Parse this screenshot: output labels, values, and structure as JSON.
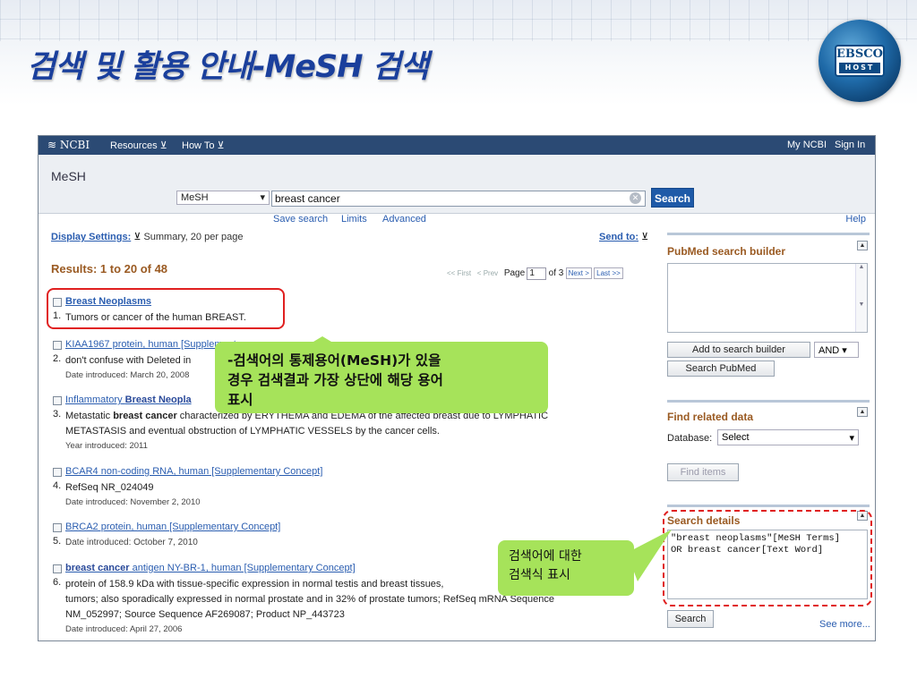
{
  "slide": {
    "title": "검색 및 활용 안내-MeSH 검색",
    "logo": {
      "line1": "EBSCO",
      "line2": "HOST"
    }
  },
  "topbar": {
    "brand": "NCBI",
    "resources": "Resources",
    "howto": "How To",
    "my_ncbi": "My NCBI",
    "sign_in": "Sign In"
  },
  "masthead": {
    "db_title": "MeSH",
    "db_select": "MeSH",
    "search_value": "breast cancer",
    "search_button": "Search",
    "links": [
      "Save search",
      "Limits",
      "Advanced"
    ],
    "help": "Help"
  },
  "results_header": {
    "display_settings": "Display Settings:",
    "display_value": "Summary, 20 per page",
    "send_to": "Send to:",
    "results_count": "Results: 1 to 20 of 48",
    "pager": {
      "first": "<< First",
      "prev": "< Prev",
      "page_label": "Page",
      "page": "1",
      "of": "of 3",
      "next": "Next >",
      "last": "Last >>"
    }
  },
  "results": [
    {
      "num": "1.",
      "title_bold": "Breast Neoplasms",
      "title_rest": "",
      "lines": [
        "Tumors or cancer of the human BREAST."
      ],
      "date": ""
    },
    {
      "num": "2.",
      "title_bold": "",
      "title_rest": "KIAA1967 protein, human [Supplementa",
      "lines": [
        "don't confuse with Deleted in"
      ],
      "date": "Date introduced: March 20, 2008"
    },
    {
      "num": "3.",
      "title_bold": "Breast Neopla",
      "title_pre": "Inflammatory ",
      "lines_a": "Metastatic ",
      "lines_b": "breast cancer",
      "lines_c": " characterized by ERYTHEMA and EDEMA of the affected breast due to LYMPHATIC",
      "line2": "METASTASIS and eventual obstruction of LYMPHATIC VESSELS by the cancer cells.",
      "date": "Year introduced: 2011"
    },
    {
      "num": "4.",
      "title": "BCAR4 non-coding RNA, human [Supplementary Concept]",
      "lines": [
        "RefSeq NR_024049"
      ],
      "date": "Date introduced: November 2, 2010"
    },
    {
      "num": "5.",
      "title": "BRCA2 protein, human [Supplementary Concept]",
      "lines": [
        "Date introduced: October 7, 2010"
      ],
      "date": ""
    },
    {
      "num": "6.",
      "title_bold": "breast cancer",
      "title_rest": " antigen NY-BR-1, human [Supplementary Concept]",
      "lines": [
        "protein of 158.9 kDa with tissue-specific expression in normal testis and breast tissues,",
        "tumors; also sporadically expressed in normal prostate and in 32% of prostate tumors; RefSeq mRNA Sequence",
        "NM_052997; Source Sequence AF269087; Product NP_443723"
      ],
      "date": "Date introduced: April 27, 2006"
    }
  ],
  "sidebar": {
    "builder_title": "PubMed search builder",
    "add_button": "Add to search builder",
    "and_select": "AND",
    "search_pubmed": "Search PubMed",
    "related_title": "Find related data",
    "database_label": "Database:",
    "database_select": "Select",
    "find_items": "Find items",
    "details_title": "Search details",
    "details_text": "\"breast neoplasms\"[MeSH Terms] OR breast cancer[Text Word]",
    "details_search": "Search",
    "see_more": "See more..."
  },
  "callouts": {
    "main": [
      "-검색어의 통제용어(MeSH)가 있을",
      "경우 검색결과 가장 상단에 해당 용어",
      "표시"
    ],
    "side": [
      "검색어에 대한",
      "검색식 표시"
    ]
  }
}
